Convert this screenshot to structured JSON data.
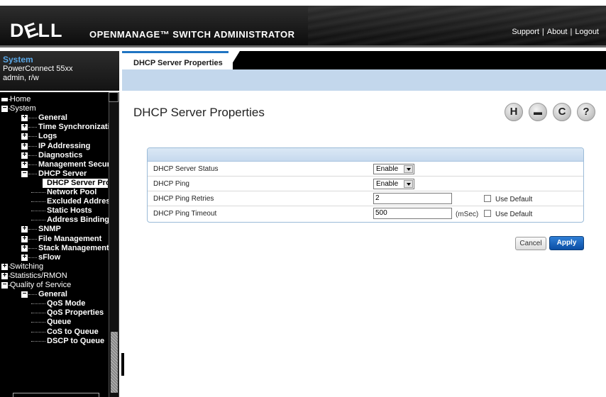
{
  "header": {
    "logo_text": "D&ELL",
    "app_title": "OPENMANAGE™ SWITCH ADMINISTRATOR",
    "links": [
      "Support",
      "About",
      "Logout"
    ],
    "link_separator": "|"
  },
  "system_panel": {
    "title": "System",
    "model": "PowerConnect 55xx",
    "user": "admin, r/w"
  },
  "tree": {
    "items": [
      {
        "label": "Home",
        "level": 0,
        "icon": "home-icon"
      },
      {
        "label": "System",
        "level": 0,
        "expander": "-"
      },
      {
        "label": "General",
        "level": 1,
        "expander": "+"
      },
      {
        "label": "Time Synchronization",
        "level": 1,
        "expander": "+"
      },
      {
        "label": "Logs",
        "level": 1,
        "expander": "+"
      },
      {
        "label": "IP Addressing",
        "level": 1,
        "expander": "+"
      },
      {
        "label": "Diagnostics",
        "level": 1,
        "expander": "+"
      },
      {
        "label": "Management Security",
        "level": 1,
        "expander": "+"
      },
      {
        "label": "DHCP Server",
        "level": 1,
        "expander": "-"
      },
      {
        "label": "DHCP Server Prop",
        "level": 2,
        "selected": true
      },
      {
        "label": "Network Pool",
        "level": 2
      },
      {
        "label": "Excluded Address",
        "level": 2
      },
      {
        "label": "Static Hosts",
        "level": 2
      },
      {
        "label": "Address Binding",
        "level": 2
      },
      {
        "label": "SNMP",
        "level": 1,
        "expander": "+"
      },
      {
        "label": "File Management",
        "level": 1,
        "expander": "+"
      },
      {
        "label": "Stack Management",
        "level": 1,
        "expander": "+"
      },
      {
        "label": "sFlow",
        "level": 1,
        "expander": "+"
      },
      {
        "label": "Switching",
        "level": 0,
        "expander": "+"
      },
      {
        "label": "Statistics/RMON",
        "level": 0,
        "expander": "+"
      },
      {
        "label": "Quality of Service",
        "level": 0,
        "expander": "-"
      },
      {
        "label": "General",
        "level": 1,
        "expander": "-"
      },
      {
        "label": "QoS Mode",
        "level": 2
      },
      {
        "label": "QoS Properties",
        "level": 2
      },
      {
        "label": "Queue",
        "level": 2
      },
      {
        "label": "CoS to Queue",
        "level": 2
      },
      {
        "label": "DSCP to Queue",
        "level": 2
      }
    ]
  },
  "tab": {
    "label": "DHCP Server Properties"
  },
  "page": {
    "title": "DHCP Server Properties",
    "tools": [
      "save-icon",
      "print-icon",
      "refresh-icon",
      "help-icon"
    ],
    "tool_glyphs": {
      "save": "H",
      "print": "▬",
      "refresh": "C",
      "help": "?"
    }
  },
  "form": {
    "status_label": "DHCP Server Status",
    "status_value": "Enable",
    "ping_label": "DHCP Ping",
    "ping_value": "Enable",
    "retries_label": "DHCP Ping Retries",
    "retries_value": "2",
    "retries_default_label": "Use Default",
    "timeout_label": "DHCP Ping Timeout",
    "timeout_value": "500",
    "timeout_unit": "(mSec)",
    "timeout_default_label": "Use Default"
  },
  "buttons": {
    "cancel": "Cancel",
    "apply": "Apply"
  }
}
